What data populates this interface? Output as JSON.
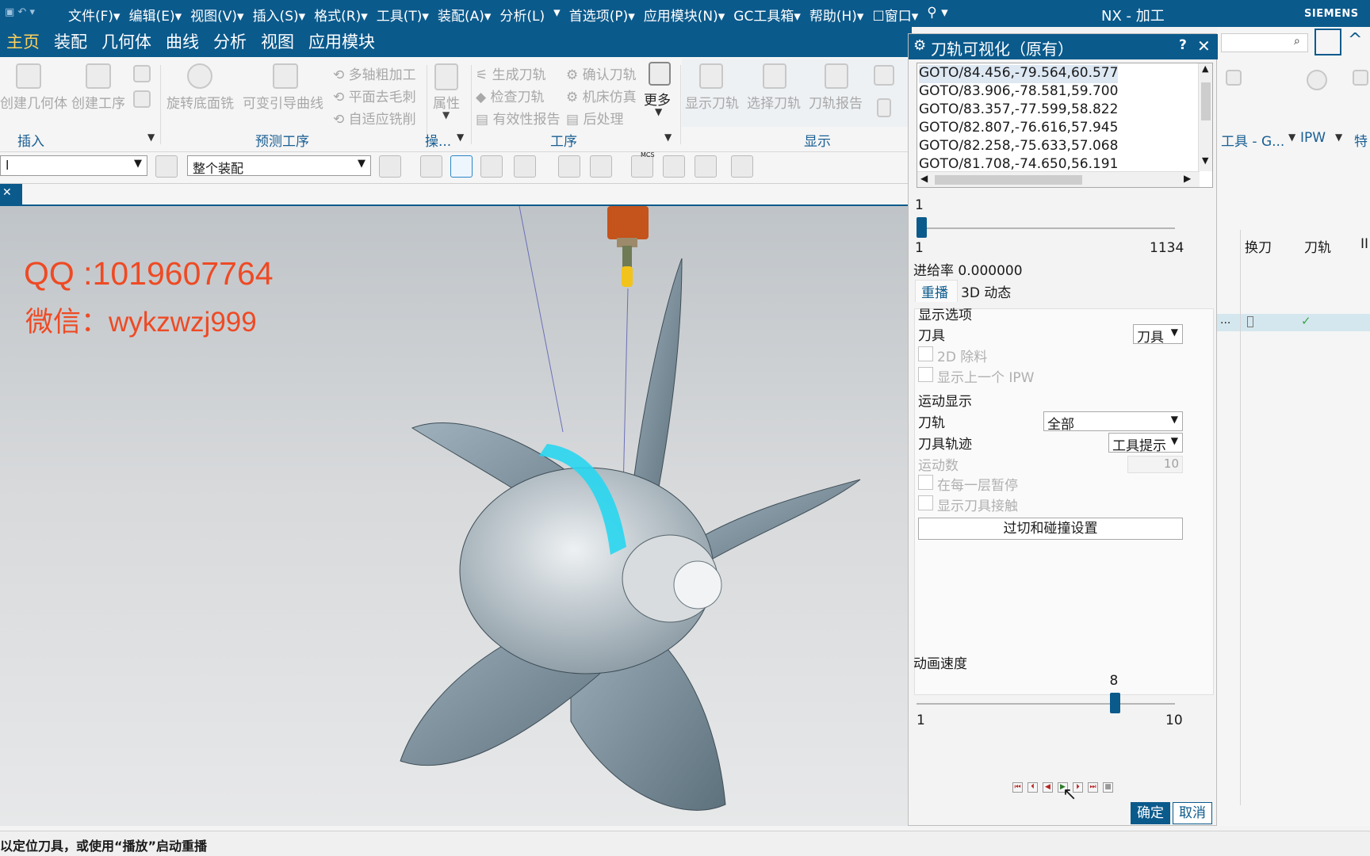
{
  "menubar": {
    "items": [
      "文件(F)▾",
      "编辑(E)▾",
      "视图(V)▾",
      "插入(S)▾",
      "格式(R)▾",
      "工具(T)▾",
      "装配(A)▾",
      "分析(L)",
      "▾",
      "首选项(P)▾",
      "应用模块(N)▾",
      "GC工具箱▾",
      "帮助(H)▾",
      "☐窗口▾",
      "⚲ ▾"
    ],
    "app_title": "NX - 加工",
    "brand": "SIEMENS"
  },
  "tabs": [
    "主页",
    "装配",
    "几何体",
    "曲线",
    "分析",
    "视图",
    "应用模块"
  ],
  "ribbon": {
    "create_geometry": "创建几何体",
    "create_operation": "创建工序",
    "rotate_floor_mill": "旋转底面铣",
    "variable_guide_curve": "可变引导曲线",
    "multi_axis_rough": "多轴粗加工",
    "plane_deburr": "平面去毛刺",
    "adaptive_mill": "自适应铣削",
    "properties": "属性",
    "generate_toolpath": "生成刀轨",
    "verify_toolpath": "确认刀轨",
    "check_toolpath": "检查刀轨",
    "machine_sim": "机床仿真",
    "validity_report": "有效性报告",
    "postprocess": "后处理",
    "more": "更多",
    "show_toolpath": "显示刀轨",
    "select_toolpath": "选择刀轨",
    "toolpath_report": "刀轨报告",
    "groups": {
      "insert": "插入",
      "predict": "预测工序",
      "operation_short": "操...",
      "operation": "工序",
      "display": "显示"
    }
  },
  "toolbar2": {
    "filter_value": "l",
    "assembly_scope": "整个装配",
    "mcs_label": "MCS"
  },
  "watermark": {
    "qq": "QQ :1019607764",
    "wechat": "微信：wykzwzj999"
  },
  "right_pane": {
    "tool_group": "工具 - G...",
    "ipw": "IPW",
    "feature": "特",
    "col_tool_change": "换刀",
    "col_toolpath": "刀轨",
    "col_extra": "II",
    "row_dots": "...",
    "row_check": "✓"
  },
  "dialog": {
    "title": "刀轨可视化（原有）",
    "goto_lines": [
      "GOTO/84.456,-79.564,60.577",
      "GOTO/83.906,-78.581,59.700",
      "GOTO/83.357,-77.599,58.822",
      "GOTO/82.807,-76.616,57.945",
      "GOTO/82.258,-75.633,57.068",
      "GOTO/81.708,-74.650,56.191"
    ],
    "position_current": "1",
    "position_min": "1",
    "position_max": "1134",
    "position_fraction": 0.0,
    "feedrate": "进给率 0.000000",
    "tab_replay": "重播",
    "tab_3d": "3D 动态",
    "display_options": "显示选项",
    "tool_label": "刀具",
    "tool_value": "刀具",
    "remove_2d": "2D 除料",
    "show_prev_ipw": "显示上一个 IPW",
    "motion_display": "运动显示",
    "toolpath_label": "刀轨",
    "toolpath_value": "全部",
    "tool_trace_label": "刀具轨迹",
    "tool_trace_value": "工具提示",
    "motion_count_label": "运动数",
    "motion_count_value": "10",
    "pause_each_layer": "在每一层暂停",
    "show_tool_contact": "显示刀具接触",
    "gouge_button": "过切和碰撞设置",
    "anim_speed": "动画速度",
    "speed_value": "8",
    "speed_min": "1",
    "speed_max": "10",
    "speed_fraction": 0.778,
    "ok": "确定",
    "cancel": "取消"
  },
  "status": "以定位刀具，或使用“播放”启动重播",
  "colors": {
    "accent": "#0b5a8c",
    "watermark": "#ee4a24",
    "toolpath_highlight": "#28d6f0"
  }
}
